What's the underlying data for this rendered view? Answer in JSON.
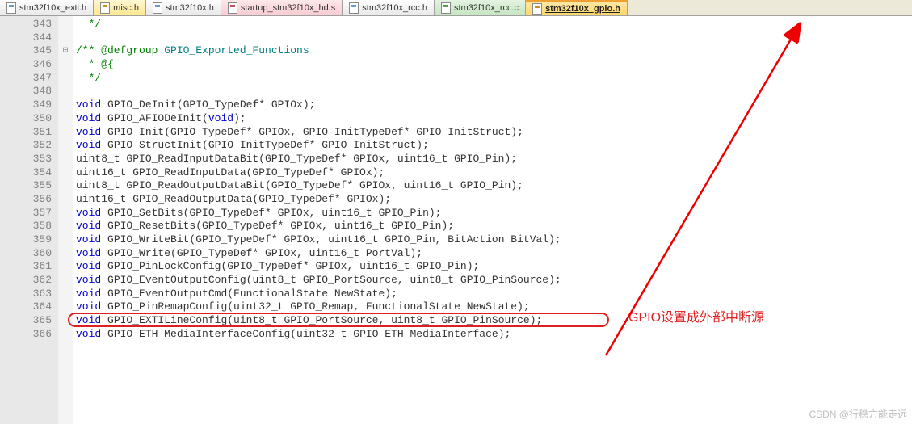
{
  "tabs": [
    {
      "label": "stm32f10x_exti.h",
      "cls": ""
    },
    {
      "label": "misc.h",
      "cls": "misc"
    },
    {
      "label": "stm32f10x.h",
      "cls": ""
    },
    {
      "label": "startup_stm32f10x_hd.s",
      "cls": "pink"
    },
    {
      "label": "stm32f10x_rcc.h",
      "cls": ""
    },
    {
      "label": "stm32f10x_rcc.c",
      "cls": "green"
    },
    {
      "label": "stm32f10x_gpio.h",
      "cls": "active"
    }
  ],
  "lines": {
    "n343": "343",
    "n344": "344",
    "n345": "345",
    "n346": "346",
    "n347": "347",
    "n348": "348",
    "n349": "349",
    "n350": "350",
    "n351": "351",
    "n352": "352",
    "n353": "353",
    "n354": "354",
    "n355": "355",
    "n356": "356",
    "n357": "357",
    "n358": "358",
    "n359": "359",
    "n360": "360",
    "n361": "361",
    "n362": "362",
    "n363": "363",
    "n364": "364",
    "n365": "365",
    "n366": "366"
  },
  "code": {
    "c343": "  */",
    "c344": "",
    "c345_a": "/** @defgroup ",
    "c345_b": "GPIO_Exported_Functions",
    "c346": "  * @{",
    "c347": "  */",
    "c348": "",
    "c349_v": "void",
    "c349_r": " GPIO_DeInit(GPIO_TypeDef* GPIOx);",
    "c350_v": "void",
    "c350_r": " GPIO_AFIODeInit(",
    "c350_v2": "void",
    "c350_r2": ");",
    "c351_v": "void",
    "c351_r": " GPIO_Init(GPIO_TypeDef* GPIOx, GPIO_InitTypeDef* GPIO_InitStruct);",
    "c352_v": "void",
    "c352_r": " GPIO_StructInit(GPIO_InitTypeDef* GPIO_InitStruct);",
    "c353": "uint8_t GPIO_ReadInputDataBit(GPIO_TypeDef* GPIOx, uint16_t GPIO_Pin);",
    "c354": "uint16_t GPIO_ReadInputData(GPIO_TypeDef* GPIOx);",
    "c355": "uint8_t GPIO_ReadOutputDataBit(GPIO_TypeDef* GPIOx, uint16_t GPIO_Pin);",
    "c356": "uint16_t GPIO_ReadOutputData(GPIO_TypeDef* GPIOx);",
    "c357_v": "void",
    "c357_r": " GPIO_SetBits(GPIO_TypeDef* GPIOx, uint16_t GPIO_Pin);",
    "c358_v": "void",
    "c358_r": " GPIO_ResetBits(GPIO_TypeDef* GPIOx, uint16_t GPIO_Pin);",
    "c359_v": "void",
    "c359_r": " GPIO_WriteBit(GPIO_TypeDef* GPIOx, uint16_t GPIO_Pin, BitAction BitVal);",
    "c360_v": "void",
    "c360_r": " GPIO_Write(GPIO_TypeDef* GPIOx, uint16_t PortVal);",
    "c361_v": "void",
    "c361_r": " GPIO_PinLockConfig(GPIO_TypeDef* GPIOx, uint16_t GPIO_Pin);",
    "c362_v": "void",
    "c362_r": " GPIO_EventOutputConfig(uint8_t GPIO_PortSource, uint8_t GPIO_PinSource);",
    "c363_v": "void",
    "c363_r": " GPIO_EventOutputCmd(FunctionalState NewState);",
    "c364_v": "void",
    "c364_r": " GPIO_PinRemapConfig(uint32_t GPIO_Remap, FunctionalState NewState);",
    "c365_v": "void",
    "c365_r": " GPIO_EXTILineConfig(uint8_t GPIO_PortSource, uint8_t GPIO_PinSource);",
    "c366_v": "void",
    "c366_r": " GPIO_ETH_MediaInterfaceConfig(uint32_t GPIO_ETH_MediaInterface);"
  },
  "fold": {
    "f345": "⊟"
  },
  "annotation": "GPIO设置成外部中断源",
  "watermark": "CSDN @行稳方能走远"
}
